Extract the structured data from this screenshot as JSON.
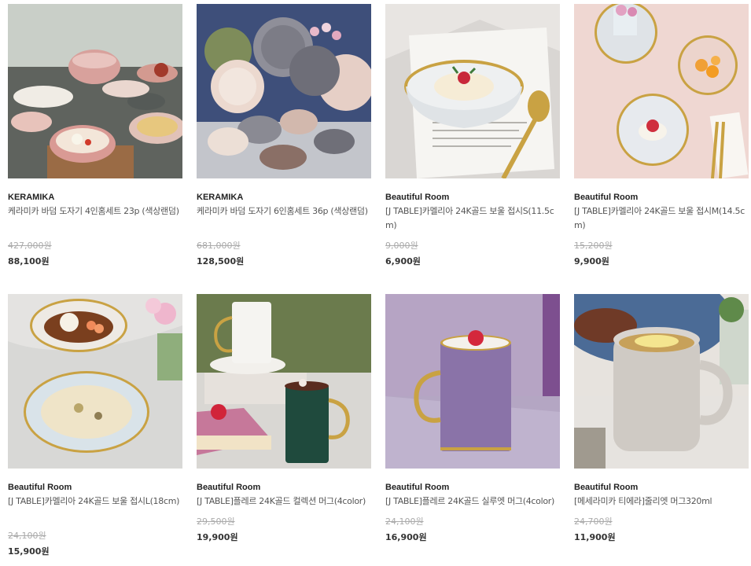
{
  "products": [
    {
      "brand": "KERAMIKA",
      "name": "케라미카 바덤 도자기 4인홈세트 23p (색상랜덤)",
      "original_price": "427,000원",
      "price": "88,100원",
      "image": "pink-dinnerware-set-photo"
    },
    {
      "brand": "KERAMIKA",
      "name": "케라미카 바덤 도자기 6인홈세트 36p (색상랜덤)",
      "original_price": "681,000원",
      "price": "128,500원",
      "image": "stacked-dinnerware-photo"
    },
    {
      "brand": "Beautiful Room",
      "name": "[J TABLE]카멜리아 24K골드 보울 접시S(11.5cm)",
      "original_price": "9,000원",
      "price": "6,900원",
      "image": "gold-rim-bowl-icecream-photo"
    },
    {
      "brand": "Beautiful Room",
      "name": "[J TABLE]카멜리아 24K골드 보울 접시M(14.5cm)",
      "original_price": "15,200원",
      "price": "9,900원",
      "image": "scalloped-bowls-pink-table-photo"
    },
    {
      "brand": "Beautiful Room",
      "name": "[J TABLE]카멜리아 24K골드 보울 접시L(18cm)",
      "original_price": "24,100원",
      "price": "15,900원",
      "image": "pasta-bowls-marble-photo"
    },
    {
      "brand": "Beautiful Room",
      "name": "[J TABLE]플레르 24K골드 컬렉션 머그(4color)",
      "original_price": "29,500원",
      "price": "19,900원",
      "image": "gold-handle-mugs-cake-photo"
    },
    {
      "brand": "Beautiful Room",
      "name": "[J TABLE]플레르 24K골드 실루엣 머그(4color)",
      "original_price": "24,100원",
      "price": "16,900원",
      "image": "purple-mug-photo"
    },
    {
      "brand": "Beautiful Room",
      "name": "[메세라미카 티에라]줄리엣 머그320ml",
      "original_price": "24,700원",
      "price": "11,900원",
      "image": "grey-mug-lemon-tea-photo"
    }
  ]
}
